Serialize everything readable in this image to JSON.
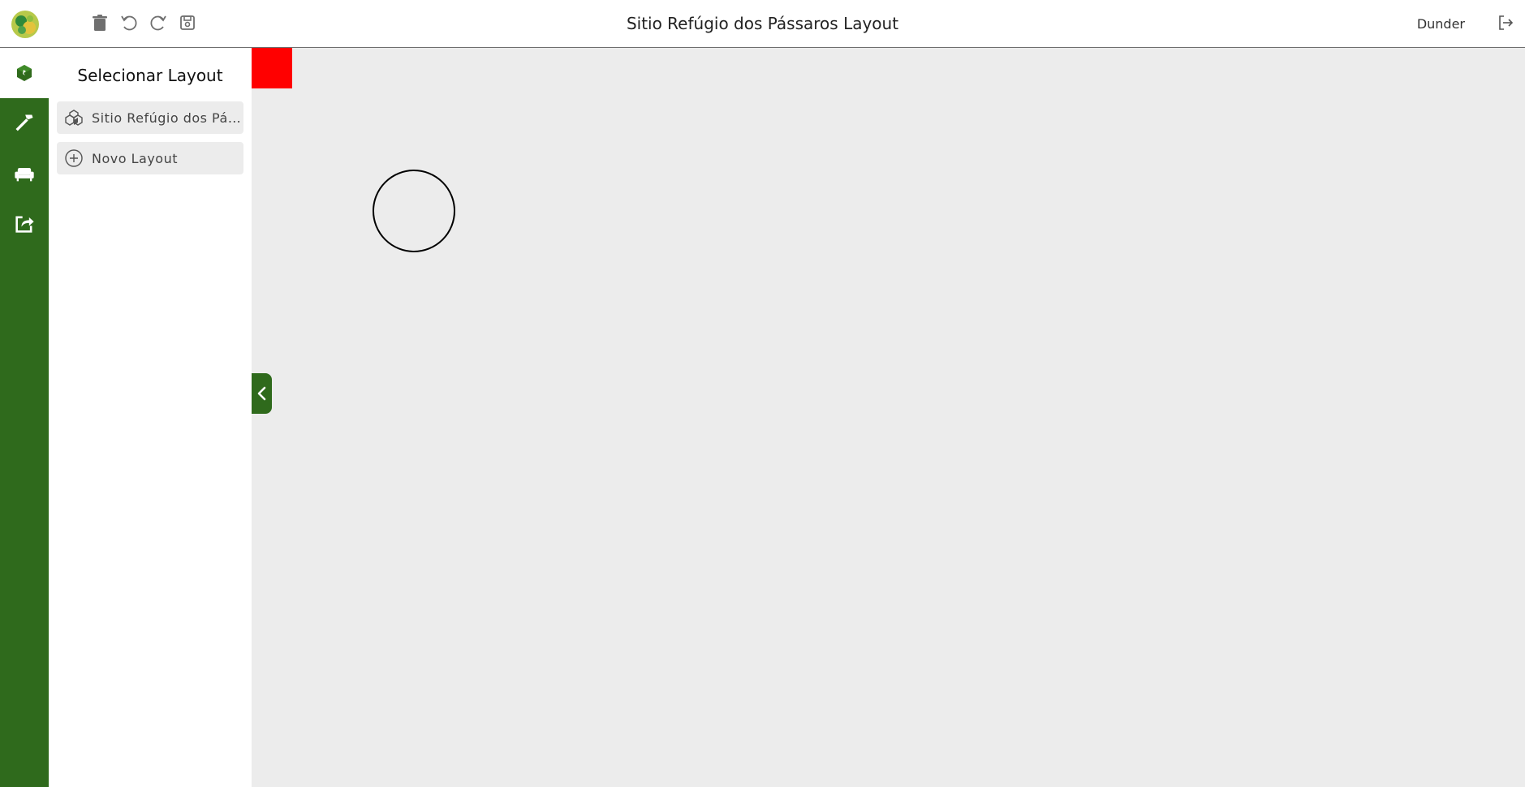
{
  "header": {
    "title": "Sitio Refúgio dos Pássaros Layout",
    "username": "Dunder",
    "icons": [
      "trash-icon",
      "undo-icon",
      "redo-icon",
      "save-icon",
      "logout-icon"
    ]
  },
  "rail": {
    "items": [
      {
        "icon": "layout-cube-icon",
        "active": true
      },
      {
        "icon": "hammer-icon",
        "active": false
      },
      {
        "icon": "armchair-icon",
        "active": false
      },
      {
        "icon": "share-icon",
        "active": false
      }
    ]
  },
  "panel": {
    "title": "Selecionar Layout",
    "layouts": [
      {
        "label": "Sitio Refúgio dos Pássaros Layout",
        "icon": "cubes-icon"
      },
      {
        "label": "Novo Layout",
        "icon": "add-circle-icon"
      }
    ]
  },
  "colors": {
    "brand_green": "#2f6a1c",
    "canvas_bg": "#ececec",
    "red_object": "#ff0000"
  }
}
